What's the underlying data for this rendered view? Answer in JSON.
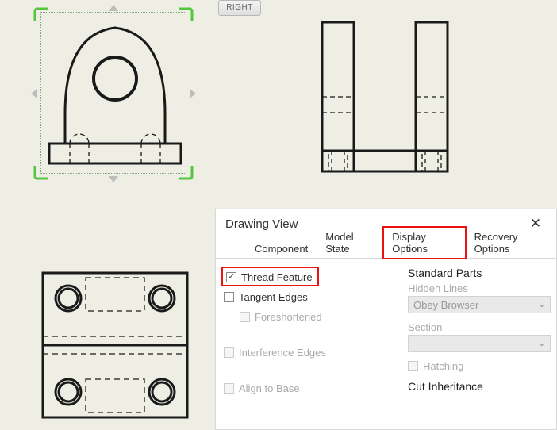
{
  "viewcube": {
    "label": "RIGHT"
  },
  "dialog": {
    "title": "Drawing View",
    "tabs": {
      "component": "Component",
      "model_state": "Model State",
      "display_options": "Display Options",
      "recovery_options": "Recovery Options"
    },
    "left": {
      "thread_feature": "Thread Feature",
      "tangent_edges": "Tangent Edges",
      "foreshortened": "Foreshortened",
      "interference_edges": "Interference Edges",
      "align_to_base": "Align to Base"
    },
    "right": {
      "standard_parts": "Standard Parts",
      "hidden_lines": "Hidden Lines",
      "hidden_lines_value": "Obey Browser",
      "section": "Section",
      "section_value": "",
      "hatching": "Hatching",
      "cut_inheritance": "Cut Inheritance"
    }
  }
}
